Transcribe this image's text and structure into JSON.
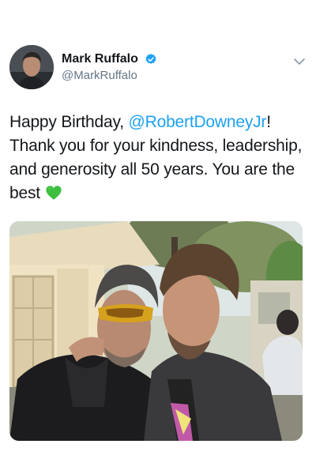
{
  "author": {
    "display_name": "Mark Ruffalo",
    "handle": "@MarkRuffalo",
    "verified": true
  },
  "icons": {
    "verified": "verified-badge-icon",
    "menu": "chevron-down-icon",
    "heart": "green-heart-emoji"
  },
  "tweet": {
    "text_before": "Happy Birthday, ",
    "mention": "@RobertDowneyJr",
    "text_after": "! Thank you for your kindness, leadership, and generosity all 50 years. You are the best "
  },
  "colors": {
    "link": "#1da1f2",
    "verified": "#1da1f2",
    "secondary_text": "#657786",
    "heart": "#3fbf3f"
  }
}
